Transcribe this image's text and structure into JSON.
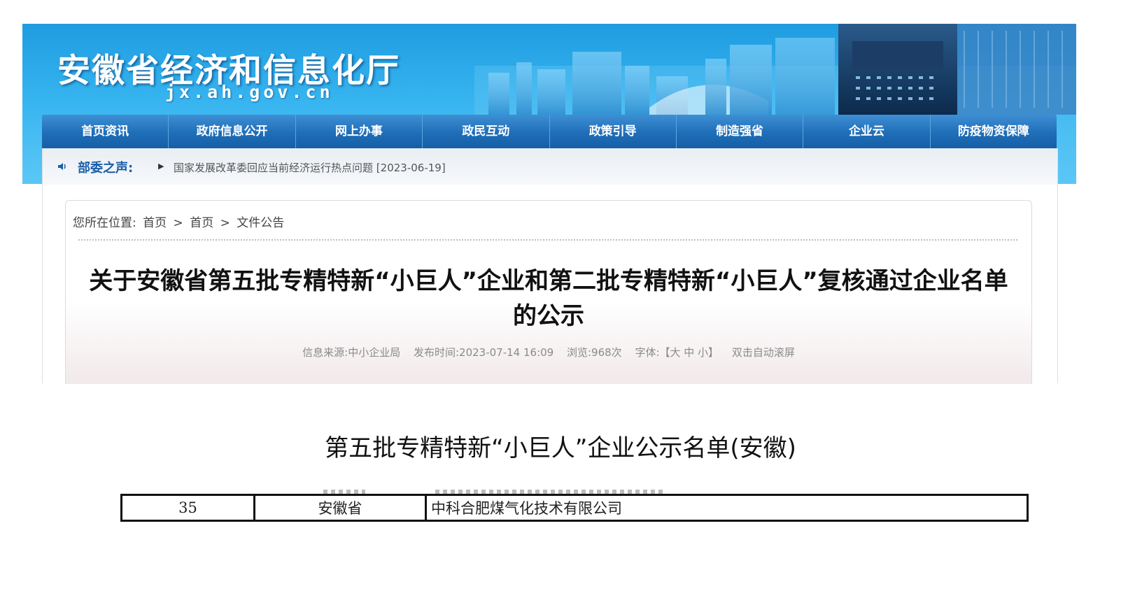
{
  "header": {
    "site_title": "安徽省经济和信息化厅",
    "site_domain": "jx.ah.gov.cn"
  },
  "nav": {
    "items": [
      "首页资讯",
      "政府信息公开",
      "网上办事",
      "政民互动",
      "政策引导",
      "制造强省",
      "企业云",
      "防疫物资保障"
    ]
  },
  "ticker": {
    "label": "部委之声:",
    "headline": "国家发展改革委回应当前经济运行热点问题",
    "date": "[2023-06-19]"
  },
  "breadcrumb": {
    "prefix": "您所在位置:",
    "items": [
      "首页",
      "首页",
      "文件公告"
    ],
    "separator": ">"
  },
  "article": {
    "title": "关于安徽省第五批专精特新“小巨人”企业和第二批专精特新“小巨人”复核通过企业名单的公示",
    "meta": {
      "source": "信息来源:中小企业局",
      "published": "发布时间:2023-07-14 16:09",
      "views": "浏览:968次",
      "font_size": "字体:【大 中 小】",
      "auto_scroll": "双击自动滚屏"
    }
  },
  "list": {
    "heading": "第五批专精特新“小巨人”企业公示名单(安徽)",
    "rows": [
      {
        "no": "35",
        "province": "安徽省",
        "company": "中科合肥煤气化技术有限公司"
      }
    ]
  },
  "colors": {
    "banner": "#1e9ce0",
    "nav": "#1f6eb8",
    "ticker_label": "#1a5fa8"
  },
  "icons": {
    "speaker": "speaker-icon",
    "arrow": "triangle-right-icon"
  }
}
